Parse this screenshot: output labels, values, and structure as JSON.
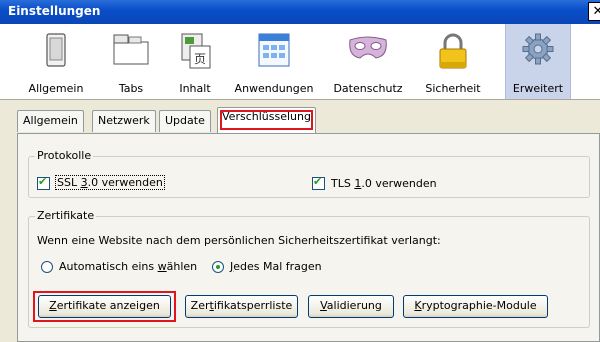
{
  "window": {
    "title": "Einstellungen",
    "close": "✕"
  },
  "toolbar": [
    {
      "label": "Allgemein",
      "icon": "general-icon"
    },
    {
      "label": "Tabs",
      "icon": "tabs-icon"
    },
    {
      "label": "Inhalt",
      "icon": "content-icon"
    },
    {
      "label": "Anwendungen",
      "icon": "applications-icon"
    },
    {
      "label": "Datenschutz",
      "icon": "privacy-mask-icon"
    },
    {
      "label": "Sicherheit",
      "icon": "lock-icon"
    },
    {
      "label": "Erweitert",
      "icon": "gear-icon",
      "active": true
    }
  ],
  "tabs": [
    "Allgemein",
    "Netzwerk",
    "Update",
    "Verschlüsselung"
  ],
  "protocols": {
    "legend": "Protokolle",
    "ssl_pre": "SSL ",
    "ssl_u": "3",
    "ssl_post": ".0 verwenden",
    "ssl_checked": true,
    "tls_pre": "TLS ",
    "tls_u": "1",
    "tls_post": ".0 verwenden",
    "tls_checked": true
  },
  "certificates": {
    "legend": "Zertifikate",
    "prompt": "Wenn eine Website nach dem persönlichen Sicherheitszertifikat verlangt:",
    "auto_pre": "Automatisch eins ",
    "auto_u": "w",
    "auto_post": "ählen",
    "ask_u": "J",
    "ask_post": "edes Mal fragen",
    "selected": "ask"
  },
  "buttons": {
    "show_u": "Z",
    "show_post": "ertifikate anzeigen",
    "crl_pre": "Zer",
    "crl_u": "t",
    "crl_post": "ifikatsperrliste",
    "validation_u": "V",
    "validation_post": "alidierung",
    "crypto_u": "K",
    "crypto_post": "ryptographie-Module"
  },
  "colors": {
    "highlight": "#e0161f",
    "titlebar": "#0a4fc9",
    "check": "#21a121"
  }
}
